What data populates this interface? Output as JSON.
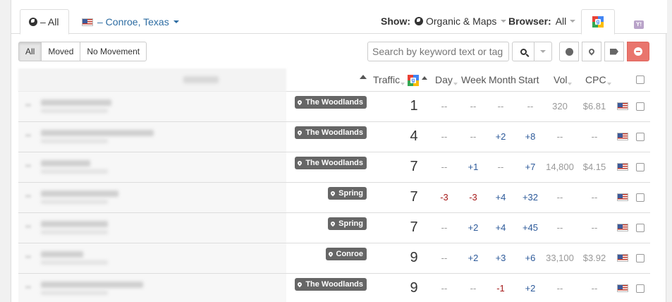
{
  "tabs": {
    "all_label": "– All",
    "location_label": "– Conroe, Texas"
  },
  "show": {
    "label": "Show:",
    "value": "Organic & Maps"
  },
  "browser": {
    "label": "Browser:",
    "value": "All"
  },
  "filters": [
    "All",
    "Moved",
    "No Movement"
  ],
  "search": {
    "placeholder": "Search by keyword text or tag"
  },
  "columns": {
    "traffic": "Traffic",
    "day": "Day",
    "week": "Week",
    "month": "Month",
    "start": "Start",
    "vol": "Vol",
    "cpc": "CPC"
  },
  "colors": {
    "positive": "#2d5a9a",
    "negative": "#a61b1b",
    "neutral": "#999999",
    "badge": "#666666",
    "clear_button": "#e9756d"
  },
  "rows": [
    {
      "location": "The Woodlands",
      "rank": "1",
      "day": "--",
      "week": "--",
      "month": "--",
      "start": "--",
      "vol": "320",
      "cpc": "$6.81"
    },
    {
      "location": "The Woodlands",
      "rank": "4",
      "day": "--",
      "week": "--",
      "month": "+2",
      "start": "+8",
      "vol": "--",
      "cpc": "--"
    },
    {
      "location": "The Woodlands",
      "rank": "7",
      "day": "--",
      "week": "+1",
      "month": "--",
      "start": "+7",
      "vol": "14,800",
      "cpc": "$4.15"
    },
    {
      "location": "Spring",
      "rank": "7",
      "day": "-3",
      "week": "-3",
      "month": "+4",
      "start": "+32",
      "vol": "--",
      "cpc": "--"
    },
    {
      "location": "Spring",
      "rank": "7",
      "day": "--",
      "week": "+2",
      "month": "+4",
      "start": "+45",
      "vol": "--",
      "cpc": "--"
    },
    {
      "location": "Conroe",
      "rank": "9",
      "day": "--",
      "week": "+2",
      "month": "+3",
      "start": "+6",
      "vol": "33,100",
      "cpc": "$3.92"
    },
    {
      "location": "The Woodlands",
      "rank": "9",
      "day": "--",
      "week": "--",
      "month": "-1",
      "start": "+2",
      "vol": "--",
      "cpc": "--"
    }
  ]
}
